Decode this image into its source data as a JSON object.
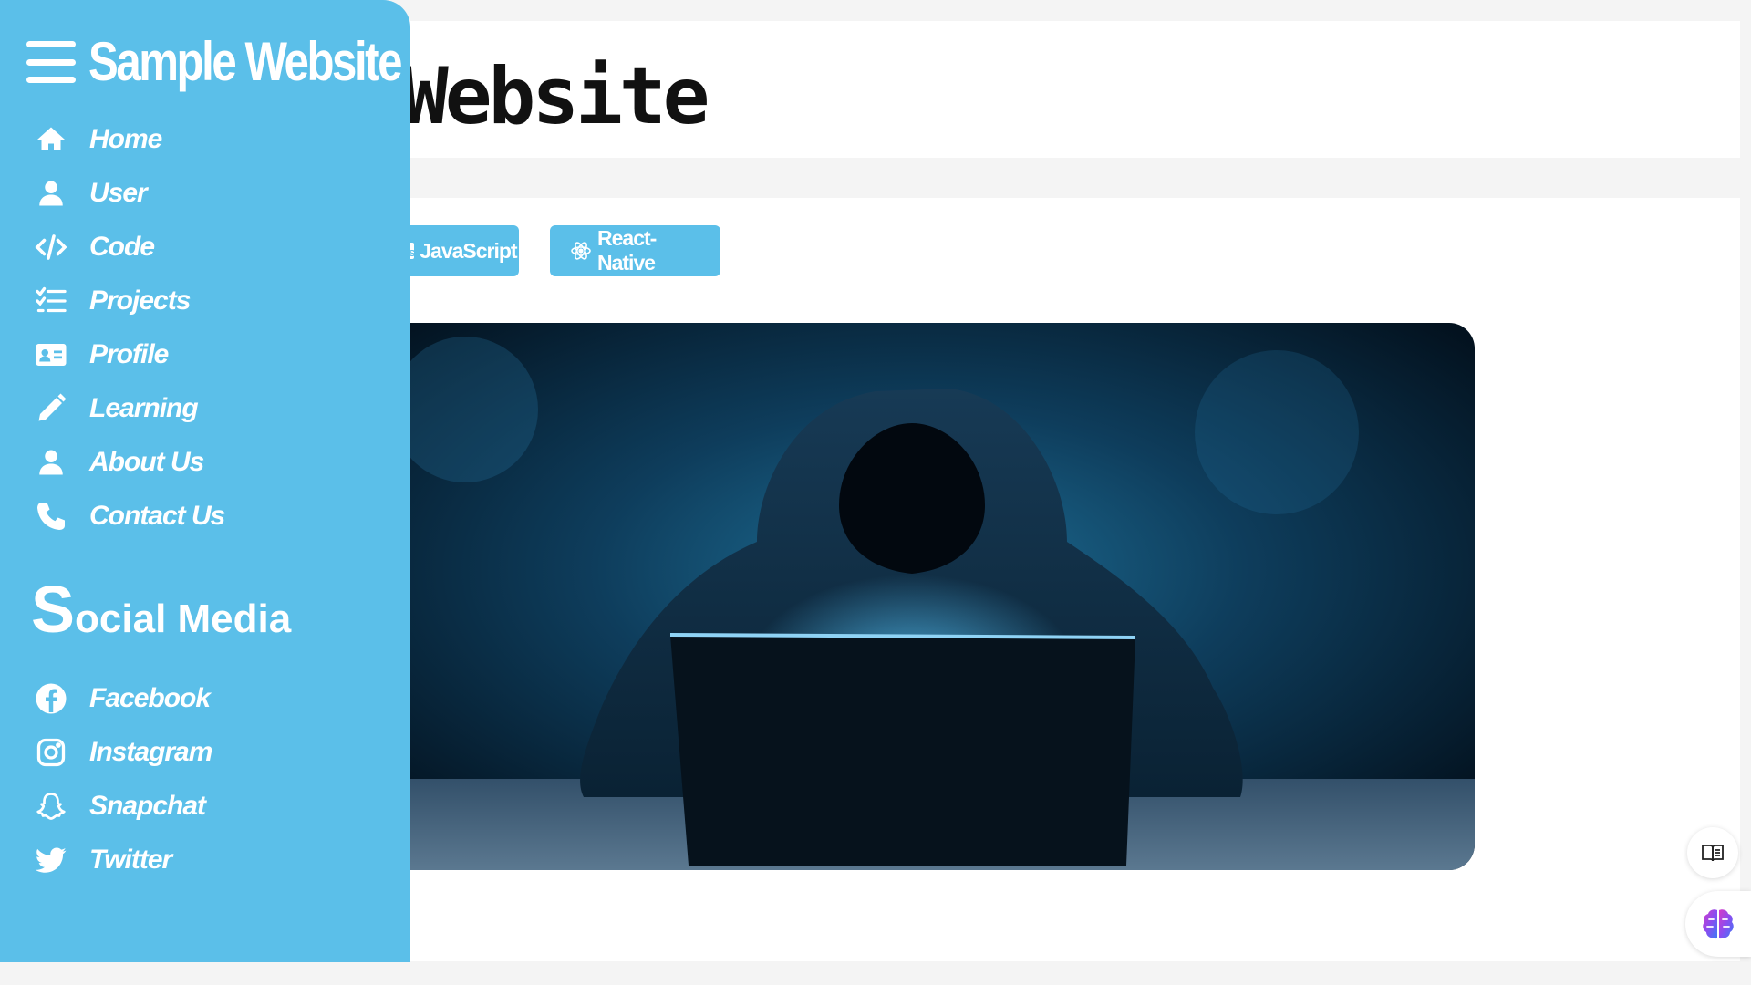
{
  "header": {
    "title": "Website"
  },
  "tags": [
    {
      "label": "JavaScript",
      "icon": "js-icon"
    },
    {
      "label": "React-Native",
      "icon": "react-icon"
    }
  ],
  "sidebar": {
    "brand": "Sample Website",
    "items": [
      {
        "label": "Home",
        "icon": "home-icon"
      },
      {
        "label": "User",
        "icon": "user-icon"
      },
      {
        "label": "Code",
        "icon": "code-icon"
      },
      {
        "label": "Projects",
        "icon": "list-check-icon"
      },
      {
        "label": "Profile",
        "icon": "id-card-icon"
      },
      {
        "label": "Learning",
        "icon": "pencil-icon"
      },
      {
        "label": "About Us",
        "icon": "user-icon"
      },
      {
        "label": "Contact Us",
        "icon": "phone-icon"
      }
    ],
    "social_heading_first": "S",
    "social_heading_rest": "ocial Media",
    "social": [
      {
        "label": "Facebook",
        "icon": "facebook-icon"
      },
      {
        "label": "Instagram",
        "icon": "instagram-icon"
      },
      {
        "label": "Snapchat",
        "icon": "snapchat-icon"
      },
      {
        "label": "Twitter",
        "icon": "twitter-icon"
      }
    ]
  },
  "colors": {
    "accent": "#5bbfe9",
    "background": "#f4f4f4",
    "card": "#ffffff"
  }
}
